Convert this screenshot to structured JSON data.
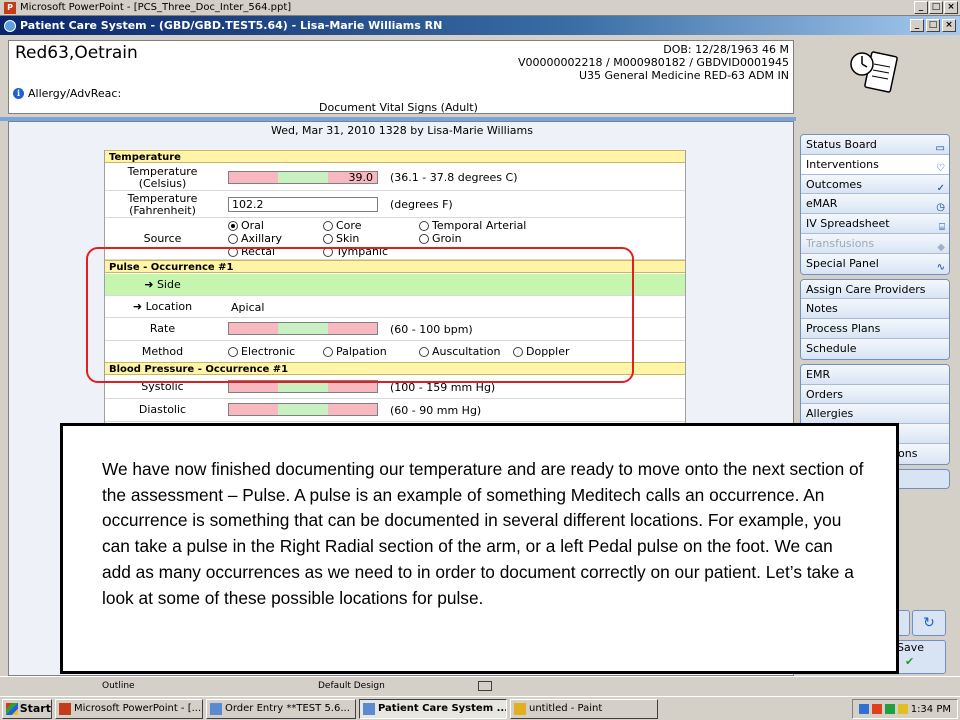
{
  "ppt_window": {
    "title": "Microsoft PowerPoint - [PCS_Three_Doc_Inter_564.ppt]"
  },
  "pcs_window": {
    "title": "Patient Care System - (GBD/GBD.TEST5.64) - Lisa-Marie Williams RN"
  },
  "patient": {
    "name": "Red63,Oetrain",
    "dob": "DOB: 12/28/1963 46 M",
    "ids": "V00000002218 / M000980182 / GBDVID0001945",
    "location": "U35 General Medicine  RED-63  ADM IN",
    "allergy": "Allergy/AdvReac:"
  },
  "document": {
    "title": "Document Vital Signs (Adult)",
    "date_line": "Wed, Mar 31, 2010 1328  by  Lisa-Marie Williams"
  },
  "form": {
    "temperature": {
      "header": "Temperature",
      "celsius_label": "Temperature (Celsius)",
      "celsius_value": "39.0",
      "celsius_range": "(36.1 - 37.8 degrees C)",
      "fahrenheit_label": "Temperature (Fahrenheit)",
      "fahrenheit_value": "102.2",
      "fahrenheit_unit": "(degrees F)",
      "source_label": "Source",
      "source_options": [
        "Oral",
        "Core",
        "Temporal Arterial",
        "Axillary",
        "Skin",
        "Groin",
        "Rectal",
        "Tympanic"
      ],
      "source_selected": "Oral"
    },
    "pulse": {
      "header": "Pulse - Occurrence #1",
      "side_label": "Side",
      "location_label": "Location",
      "location_value": "Apical",
      "rate_label": "Rate",
      "rate_range": "(60 - 100 bpm)",
      "method_label": "Method",
      "method_options": [
        "Electronic",
        "Palpation",
        "Auscultation",
        "Doppler"
      ]
    },
    "bp": {
      "header": "Blood Pressure - Occurrence #1",
      "systolic_label": "Systolic",
      "systolic_range": "(100 - 159 mm Hg)",
      "diastolic_label": "Diastolic",
      "diastolic_range": "(60 - 90 mm Hg)"
    }
  },
  "right_panel": {
    "group1": [
      "Status Board",
      "Interventions",
      "Outcomes",
      "eMAR",
      "IV Spreadsheet",
      "Transfusions",
      "Special Panel"
    ],
    "group2": [
      "Assign Care Providers",
      "Notes",
      "Process Plans",
      "Schedule"
    ],
    "group3": [
      "EMR",
      "Orders",
      "Allergies"
    ],
    "partial_label": "ions",
    "save_label": "Save"
  },
  "ppt_status": {
    "outline": "Outline",
    "design": "Default Design"
  },
  "taskbar": {
    "start": "Start",
    "tasks": [
      "Microsoft PowerPoint - [...",
      "Order Entry **TEST 5.6...",
      "Patient Care System ...",
      "untitled - Paint"
    ],
    "clock": "1:34 PM"
  },
  "callout": {
    "text": "We have now finished documenting our temperature and are ready to move onto the next section of the assessment – Pulse. A pulse is an example of something Meditech calls an occurrence. An occurrence is something that can be documented in several different locations. For example, you can take a pulse in the Right Radial section of the arm, or a left Pedal pulse on the foot. We can add as many occurrences as we need to in order to document correctly on our patient. Let’s take a look at some of these possible locations for pulse."
  }
}
